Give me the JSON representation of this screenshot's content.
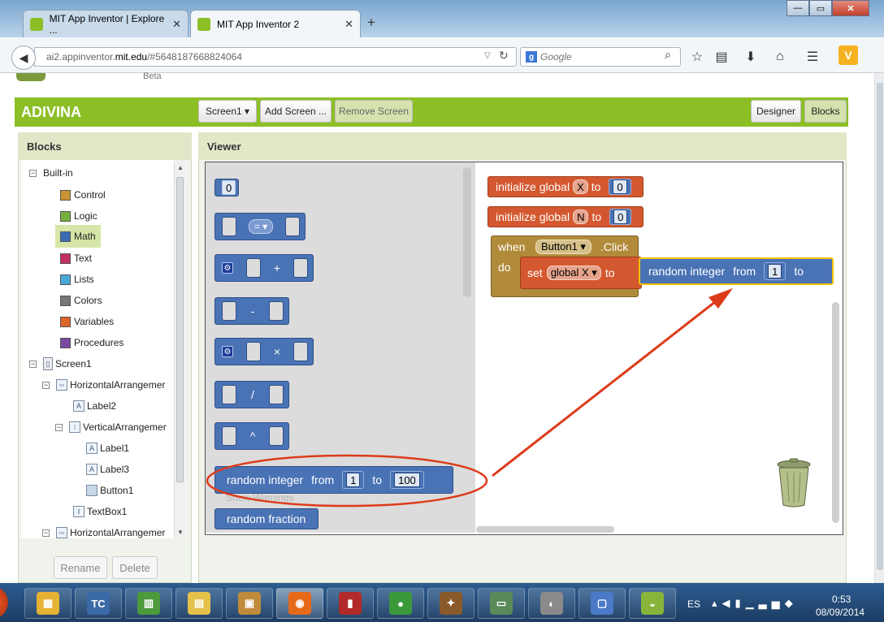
{
  "browser": {
    "tabs": [
      {
        "title": "MIT App Inventor | Explore ..."
      },
      {
        "title": "MIT App Inventor 2"
      }
    ],
    "new_tab": "+",
    "url_prefix": "ai2.appinventor.",
    "url_domain": "mit.edu",
    "url_suffix": "/#5648187668824064",
    "search_placeholder": "Google",
    "window_buttons": {
      "min": "—",
      "max": "▭",
      "close": "✕"
    }
  },
  "page": {
    "beta_label": "Beta",
    "app_name": "ADIVINA",
    "toolbar": {
      "screen": "Screen1 ▾",
      "add_screen": "Add Screen ...",
      "remove_screen": "Remove Screen",
      "designer": "Designer",
      "blocks": "Blocks"
    }
  },
  "blocks_panel": {
    "title": "Blocks",
    "builtin_label": "Built-in",
    "builtin": [
      {
        "label": "Control",
        "color": "#c89434"
      },
      {
        "label": "Logic",
        "color": "#77b03c"
      },
      {
        "label": "Math",
        "color": "#3c6bb5"
      },
      {
        "label": "Text",
        "color": "#c3305f"
      },
      {
        "label": "Lists",
        "color": "#48a9d6"
      },
      {
        "label": "Colors",
        "color": "#777777"
      },
      {
        "label": "Variables",
        "color": "#dd6629"
      },
      {
        "label": "Procedures",
        "color": "#7b4aa0"
      }
    ],
    "components": {
      "screen": "Screen1",
      "h_arr1": "HorizontalArrangemer",
      "label2": "Label2",
      "v_arr": "VerticalArrangemer",
      "label1": "Label1",
      "label3": "Label3",
      "button1": "Button1",
      "textbox1": "TextBox1",
      "h_arr2": "HorizontalArrangemer"
    },
    "rename": "Rename",
    "delete": "Delete"
  },
  "viewer": {
    "title": "Viewer",
    "flyout": {
      "number": "0",
      "compare_op": "= ▾",
      "add_op": "+",
      "sub_op": "-",
      "mul_op": "×",
      "div_op": "/",
      "pow_op": "^",
      "random_integer": "random integer",
      "from": "from",
      "to": "to",
      "from_value": "1",
      "to_value": "100",
      "random_fraction": "random fraction",
      "warnings_ghost": "Show Warnings"
    },
    "workspace": {
      "init1": {
        "prefix": "initialize global",
        "name": "X",
        "to": "to",
        "value": "0"
      },
      "init2": {
        "prefix": "initialize global",
        "name": "N",
        "to": "to",
        "value": "0"
      },
      "event": {
        "when": "when",
        "component": "Button1 ▾",
        "event": ".Click",
        "do": "do"
      },
      "set": {
        "set": "set",
        "var": "global X ▾",
        "to": "to"
      },
      "random": {
        "label": "random integer",
        "from": "from",
        "from_value": "1",
        "to": "to"
      }
    }
  },
  "annotations": {
    "ellipse_color": "#dd3b1a",
    "arrow_color": "#dd3b1a"
  },
  "taskbar": {
    "apps": [
      {
        "icon": "windows-explorer-icon",
        "color": "#e6b232",
        "glyph": "▦"
      },
      {
        "icon": "tc-icon",
        "color": "#3a6aa8",
        "glyph": "TC"
      },
      {
        "icon": "chart-app-icon",
        "color": "#4c9a3c",
        "glyph": "▥"
      },
      {
        "icon": "folder-icon",
        "color": "#e6c14a",
        "glyph": "▤"
      },
      {
        "icon": "photos-icon",
        "color": "#c08b3a",
        "glyph": "▣"
      },
      {
        "icon": "firefox-icon",
        "color": "#e66a1a",
        "glyph": "◉"
      },
      {
        "icon": "books-icon",
        "color": "#b22a2a",
        "glyph": "▮"
      },
      {
        "icon": "chrome-icon",
        "color": "#3a9a3a",
        "glyph": "●"
      },
      {
        "icon": "paint-icon",
        "color": "#8a5a2a",
        "glyph": "✦"
      },
      {
        "icon": "monitor-icon",
        "color": "#5a8a5a",
        "glyph": "▭"
      },
      {
        "icon": "android-emulator-icon",
        "color": "#8a8a8a",
        "glyph": "◐"
      },
      {
        "icon": "remote-desktop-icon",
        "color": "#4a7ac8",
        "glyph": "▢"
      },
      {
        "icon": "android-icon",
        "color": "#86b53a",
        "glyph": "◒"
      }
    ],
    "lang": "ES",
    "time": "0:53",
    "date": "08/09/2014"
  }
}
